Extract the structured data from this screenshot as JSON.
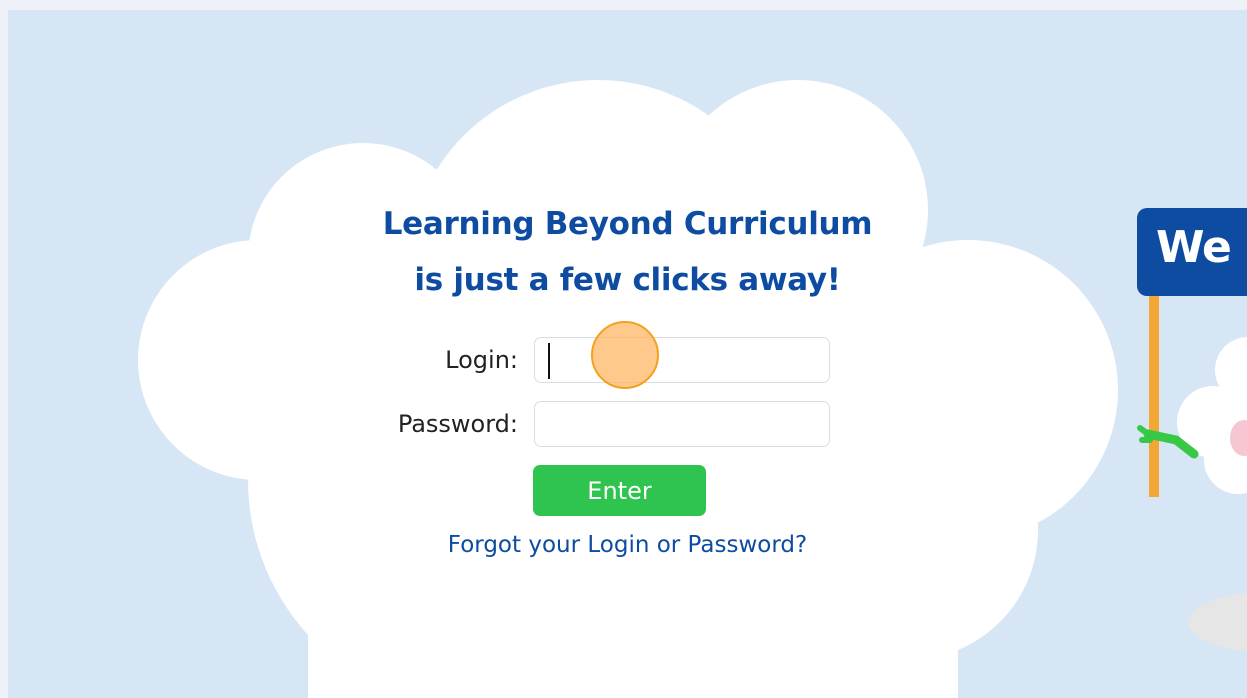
{
  "heading": {
    "line1": "Learning Beyond Curriculum",
    "line2": "is just a few clicks away!"
  },
  "form": {
    "login_label": "Login:",
    "login_value": "",
    "password_label": "Password:",
    "password_value": "",
    "enter_label": "Enter",
    "forgot_link": "Forgot your Login or Password?"
  },
  "mascot": {
    "sign_text": "We"
  },
  "colors": {
    "heading": "#0d4ca0",
    "button": "#2ec44f",
    "sky": "#d6e6f5",
    "sign": "#0d4ca0"
  }
}
